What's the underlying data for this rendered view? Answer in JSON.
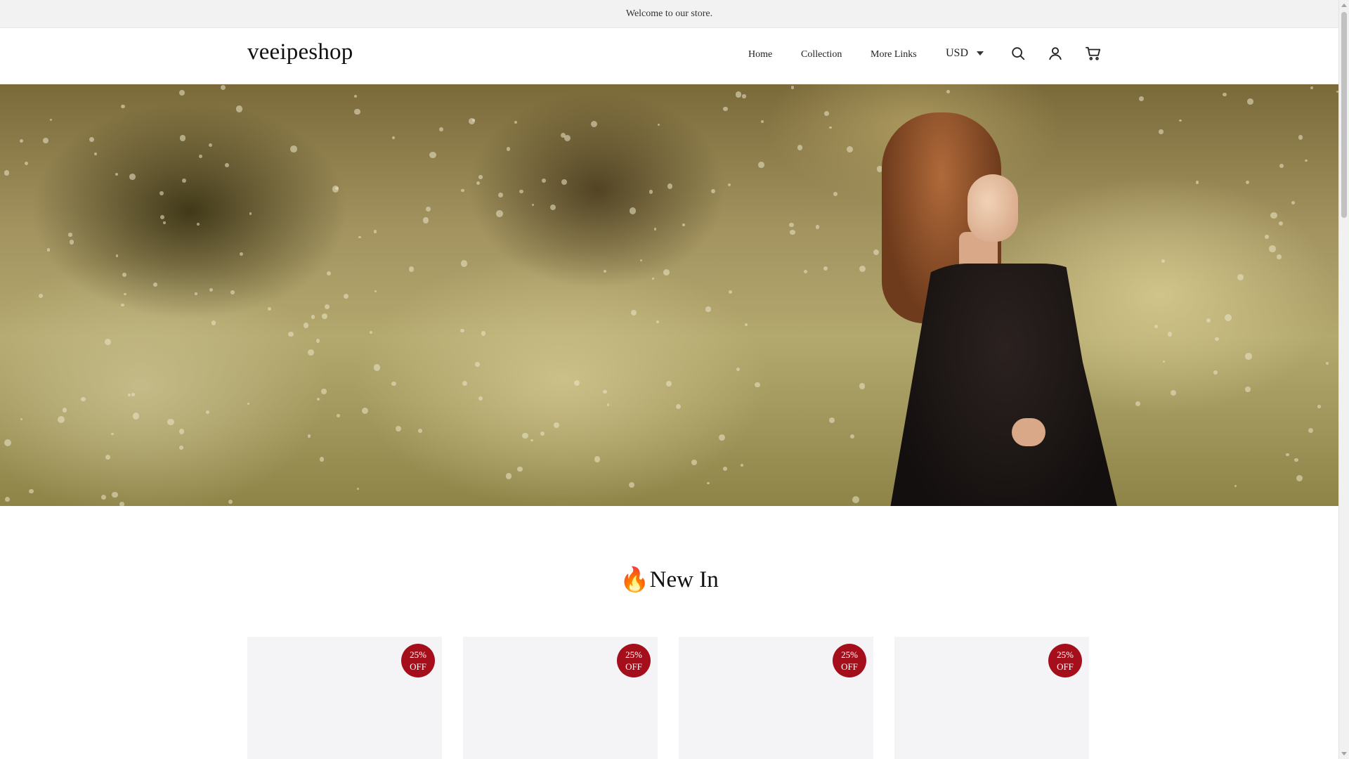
{
  "announcement": {
    "text": "Welcome to our store."
  },
  "header": {
    "logo": "veeipeshop",
    "nav": [
      {
        "label": "Home"
      },
      {
        "label": "Collection"
      },
      {
        "label": "More Links"
      }
    ],
    "currency": "USD",
    "icons": [
      "search-icon",
      "account-icon",
      "cart-icon"
    ]
  },
  "hero": {
    "image": "woman in black dress standing in a field of tall blooming plants"
  },
  "section": {
    "icon": "🔥",
    "title": "New In"
  },
  "products": [
    {
      "discount_line1": "25%",
      "discount_line2": "OFF"
    },
    {
      "discount_line1": "25%",
      "discount_line2": "OFF"
    },
    {
      "discount_line1": "25%",
      "discount_line2": "OFF"
    },
    {
      "discount_line1": "25%",
      "discount_line2": "OFF"
    }
  ],
  "colors": {
    "announcement_bg": "#f2f2f2",
    "badge": "#a50f1c",
    "card_bg": "#f4f4f6"
  }
}
